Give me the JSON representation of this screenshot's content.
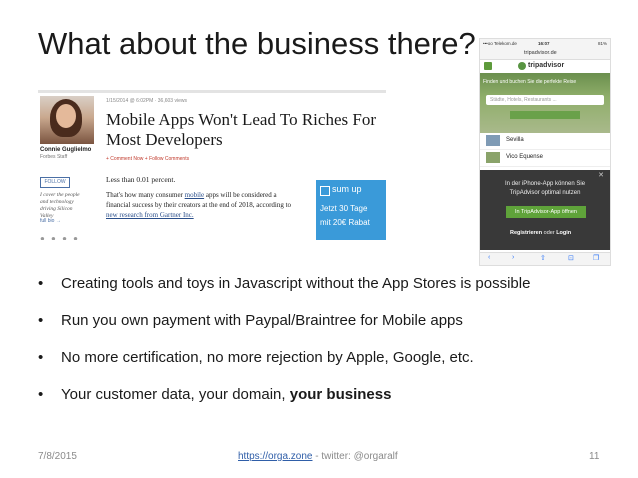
{
  "slide": {
    "title": "What about the business there?",
    "bullets": [
      {
        "text": "Creating tools and toys in Javascript without the App Stores is possible"
      },
      {
        "text": "Run you own payment with Paypal/Braintree for Mobile apps"
      },
      {
        "text": "No more certification, no more rejection by Apple, Google, etc."
      },
      {
        "text_prefix": "Your customer data, your domain, ",
        "text_bold": "your business"
      }
    ],
    "bullet_symbol": "•",
    "footer": {
      "date": "7/8/2015",
      "link": "https://orga.zone",
      "twitter": " - twitter: @orgaralf",
      "page": "11"
    }
  },
  "article": {
    "meta": "1/15/2014 @ 6:02PM · 36,603 views",
    "headline": "Mobile Apps Won't Lead To Riches For Most Developers",
    "comment_links": "+ Comment Now   + Follow Comments",
    "author": "Connie Guglielmo",
    "role": "Forbes Staff",
    "follow": "FOLLOW",
    "bio": "I cover the people and technology driving Silicon Valley",
    "full_bio": "full bio →",
    "dots": "● ● ● ●",
    "lead": "Less than 0.01 percent.",
    "body_1": "That's how many consumer ",
    "body_link1": "mobile",
    "body_2": " apps will be considered a financial success by their creators at the end of 2018, according to ",
    "body_link2": "new research from Gartner Inc.",
    "ad": {
      "logo": "sum up",
      "line1": "Jetzt 30 Tage",
      "line2": "mit 20€ Rabat"
    }
  },
  "phone": {
    "carrier": "•••oo Telekom.de",
    "time": "16:07",
    "battery": "81%",
    "url": "tripadvisor.de",
    "brand": "tripadvisor",
    "hero_tag": "Finden und buchen Sie die perfekte Reise",
    "search_placeholder": "Städte, Hotels, Restaurants ...",
    "rows": [
      "Sevilla",
      "Vico Equense"
    ],
    "overlay_msg": "In der iPhone-App können Sie TripAdvisor optimal nutzen",
    "overlay_cta": "In TripAdvisor-App öffnen",
    "register": "Registrieren",
    "or": " oder ",
    "login": "Login",
    "close": "✕",
    "toolbar": [
      "‹",
      "›",
      "⇧",
      "⊡",
      "❐"
    ]
  },
  "colors": {
    "link": "#2f5ea8",
    "tripadvisor_green": "#589442",
    "sumup_blue": "#3a9ad9"
  }
}
